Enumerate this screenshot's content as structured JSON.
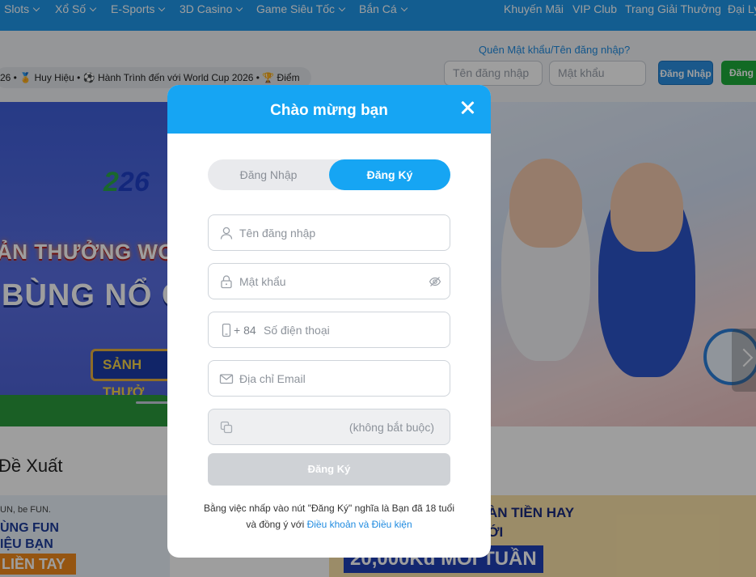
{
  "nav": {
    "items": [
      {
        "label": "Slots",
        "dropdown": true
      },
      {
        "label": "Xổ Số",
        "dropdown": true
      },
      {
        "label": "E-Sports",
        "dropdown": true
      },
      {
        "label": "3D Casino",
        "dropdown": true
      },
      {
        "label": "Game Siêu Tốc",
        "dropdown": true
      },
      {
        "label": "Bắn Cá",
        "dropdown": true
      },
      {
        "label": "Khuyến Mãi"
      },
      {
        "label": "VIP Club"
      },
      {
        "label": "Trang Giải Thưởng"
      },
      {
        "label": "Đại Lý"
      }
    ]
  },
  "header": {
    "ticker": "26 • 🏅 Huy Hiệu • ⚽ Hành Trình đến với World Cup 2026 • 🏆 Điểm",
    "forgot": "Quên Mật khẩu/Tên đăng nhập?",
    "username_placeholder": "Tên đăng nhập",
    "password_placeholder": "Mật khẩu",
    "login_button": "Đăng Nhập",
    "register_button": "Đăng"
  },
  "banner": {
    "logo": "26",
    "title1": "ẢN THƯỞNG WOR",
    "title2": "BÙNG NỔ CA",
    "badge": "SẢNH THƯỞ"
  },
  "recommend": {
    "title": "Đề Xuất"
  },
  "promos": {
    "left_lines": [
      "UN, be FUN.",
      "ÙNG FUN",
      "IỆU BẠN",
      "LIỀN TAY"
    ],
    "right_lines": [
      "ÀN TIỀN HAY",
      "ỚI",
      "20,000Kđ MỖI TUẦN"
    ]
  },
  "modal": {
    "title": "Chào mừng bạn",
    "tabs": {
      "login": "Đăng Nhập",
      "register": "Đăng Ký"
    },
    "fields": {
      "username": "Tên đăng nhập",
      "password": "Mật khẩu",
      "phone_prefix": "+ 84",
      "phone": "Số điện thoại",
      "email": "Địa chỉ Email",
      "referral": "(không bắt buộc)"
    },
    "submit": "Đăng Ký",
    "terms_text": "Bằng việc nhấp vào nút \"Đăng Ký\" nghĩa là Bạn đã 18 tuổi",
    "terms_text2": "và đồng ý với",
    "terms_link": "Điều khoản và Điều kiện"
  },
  "colors": {
    "brand": "#16a5f3",
    "nav": "#1f96e8",
    "register": "#1dab3a",
    "disabled": "#cfd2d6"
  }
}
